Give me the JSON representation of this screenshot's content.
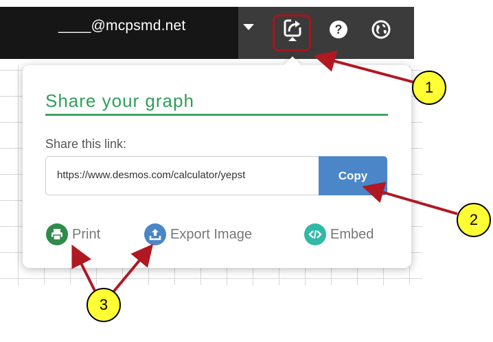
{
  "topbar": {
    "user_email": "____@mcpsmd.net",
    "icons": [
      "share-icon",
      "help-icon",
      "globe-icon"
    ]
  },
  "share_popup": {
    "title": "Share your graph",
    "share_label": "Share this link:",
    "link_value": "https://www.desmos.com/calculator/yepst",
    "copy_label": "Copy",
    "actions": [
      {
        "label": "Print",
        "icon": "print-icon"
      },
      {
        "label": "Export Image",
        "icon": "upload-icon"
      },
      {
        "label": "Embed",
        "icon": "embed-code-icon"
      }
    ]
  },
  "callouts": [
    "1",
    "2",
    "3"
  ],
  "colors": {
    "topbar_dark": "#161616",
    "topbar_gray": "#3b3b3b",
    "highlight_red": "#a8141c",
    "title_green": "#2f9e5a",
    "copy_blue": "#4a86c8",
    "print_green": "#2e8b4c",
    "export_blue": "#4a86c8",
    "embed_teal": "#2fb9a6",
    "callout_yellow": "#ffff33"
  }
}
